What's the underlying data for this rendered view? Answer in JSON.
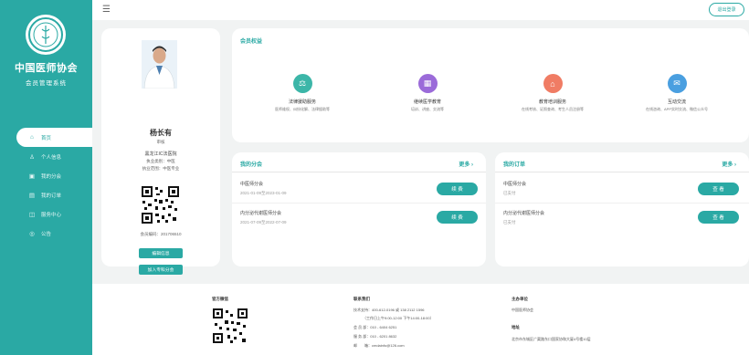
{
  "sidebar": {
    "logo_text": "CMDA",
    "title": "中国医师协会",
    "subtitle": "会员管理系统",
    "items": [
      {
        "label": "首页",
        "icon": "home-icon"
      },
      {
        "label": "个人信息",
        "icon": "user-icon"
      },
      {
        "label": "我的分会",
        "icon": "calendar-icon"
      },
      {
        "label": "我的订单",
        "icon": "order-icon"
      },
      {
        "label": "服务中心",
        "icon": "service-icon"
      },
      {
        "label": "公告",
        "icon": "notice-icon"
      }
    ]
  },
  "header": {
    "menu_icon": "☰",
    "logout": "退出登录"
  },
  "profile": {
    "name": "杨长有",
    "tag": "审核",
    "org": "黑龙江IC法医院",
    "line1": "执业类别：中医",
    "line2": "执业范围：中医专业",
    "member_no": "会员编码：201706510",
    "btn_edit": "编辑信息",
    "btn_join": "加入专科分会"
  },
  "benefits": {
    "title": "会员权益",
    "items": [
      {
        "title": "法律援助服务",
        "desc": "医师维权、纠纷化解、法律援助等",
        "color": "#3cb6a8",
        "icon": "scale-icon"
      },
      {
        "title": "继续医学教育",
        "desc": "培训、讲座、交流等",
        "color": "#9b6bd9",
        "icon": "book-icon"
      },
      {
        "title": "教育培训服务",
        "desc": "在线考核、证照查询、考生人员注册等",
        "color": "#f07c64",
        "icon": "cap-icon"
      },
      {
        "title": "互动交流",
        "desc": "在线咨询、APP实时交流、微信公众号",
        "color": "#4a9fe0",
        "icon": "chat-icon"
      }
    ]
  },
  "branches": {
    "title": "我的分会",
    "more": "更多 ›",
    "rows": [
      {
        "title": "中医师分会",
        "date": "2021-01-09至2023-01-09",
        "btn": "续 费"
      },
      {
        "title": "内分泌代谢医师分会",
        "date": "2021-07-09至2022-07-09",
        "btn": "续 费"
      }
    ]
  },
  "orders": {
    "title": "我的订单",
    "more": "更多 ›",
    "rows": [
      {
        "title": "中医师分会",
        "date": "已支付",
        "btn": "查 看"
      },
      {
        "title": "内分泌代谢医师分会",
        "date": "已支付",
        "btn": "查 看"
      }
    ]
  },
  "footer": {
    "wechat_title": "官方微信",
    "contact_title": "联系我们",
    "contact_lines": [
      "技术支持：400-612-0196 或 138 2112 1596",
      "（工作日上午9:00-12:00 下午14:00-18:00）",
      "会 员 部：010 - 6404 6251",
      "服 务 部：010 - 6201 8632",
      "邮　　箱：cmdainfo@126.com"
    ],
    "host_title": "主办单位",
    "host": "中国医师协会",
    "addr_title": "地址",
    "addr": "北京市东城区广渠路东口国家协和大厦4号楼10层"
  }
}
